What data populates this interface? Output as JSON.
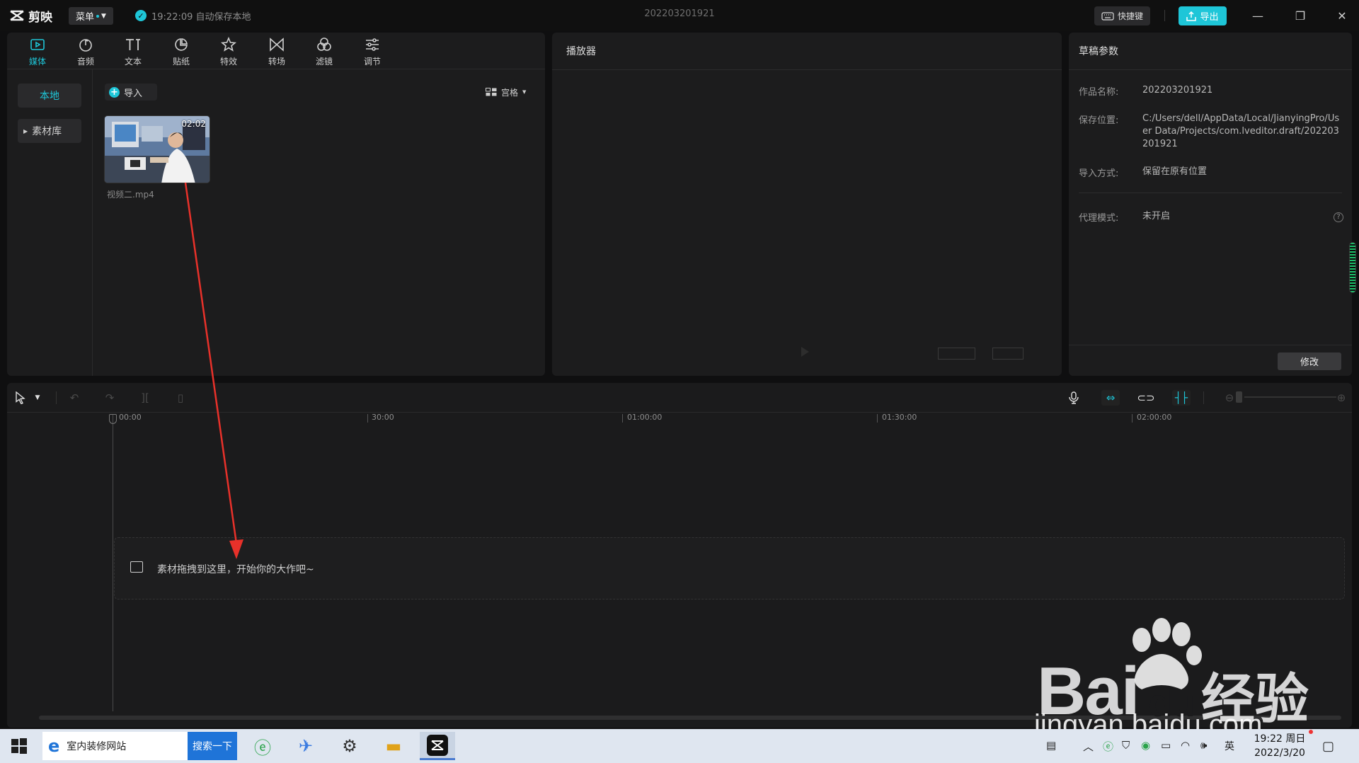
{
  "app": {
    "logo_text": "剪映",
    "menu_label": "菜单",
    "autosave_text": "19:22:09 自动保存本地",
    "project_title": "202203201921",
    "shortcut_label": "快捷键",
    "export_label": "导出"
  },
  "media_tools": [
    {
      "label": "媒体",
      "icon": "media-icon"
    },
    {
      "label": "音频",
      "icon": "audio-icon"
    },
    {
      "label": "文本",
      "icon": "text-icon"
    },
    {
      "label": "贴纸",
      "icon": "sticker-icon"
    },
    {
      "label": "特效",
      "icon": "effects-icon"
    },
    {
      "label": "转场",
      "icon": "transition-icon"
    },
    {
      "label": "滤镜",
      "icon": "filter-icon"
    },
    {
      "label": "调节",
      "icon": "adjust-icon"
    }
  ],
  "media_side": {
    "local": "本地",
    "library": "素材库"
  },
  "media": {
    "import_label": "导入",
    "view_label": "宫格",
    "clip": {
      "duration": "02:02",
      "name": "视频二.mp4"
    }
  },
  "player": {
    "title": "播放器"
  },
  "draft": {
    "title": "草稿参数",
    "fields": [
      {
        "key": "作品名称:",
        "value": "202203201921"
      },
      {
        "key": "保存位置:",
        "value": "C:/Users/dell/AppData/Local/JianyingPro/User Data/Projects/com.lveditor.draft/202203201921"
      },
      {
        "key": "导入方式:",
        "value": "保留在原有位置"
      },
      {
        "key": "代理模式:",
        "value": "未开启"
      }
    ],
    "help_glyph": "?",
    "modify_label": "修改"
  },
  "timeline": {
    "ruler": [
      "00:00",
      "30:00",
      "01:00:00",
      "01:30:00",
      "02:00:00"
    ],
    "drop_hint": "素材拖拽到这里，开始你的大作吧~"
  },
  "watermark": {
    "brand": "Bai",
    "brand_du": "du",
    "brand_cn": "经验",
    "url": "jingyan.baidu.com"
  },
  "taskbar": {
    "search_text": "室内装修网站",
    "search_button": "搜索一下",
    "ime": "英",
    "time": "19:22 周日",
    "date": "2022/3/20"
  },
  "colors": {
    "accent": "#1ec6d8",
    "annotation": "#e8312a"
  }
}
